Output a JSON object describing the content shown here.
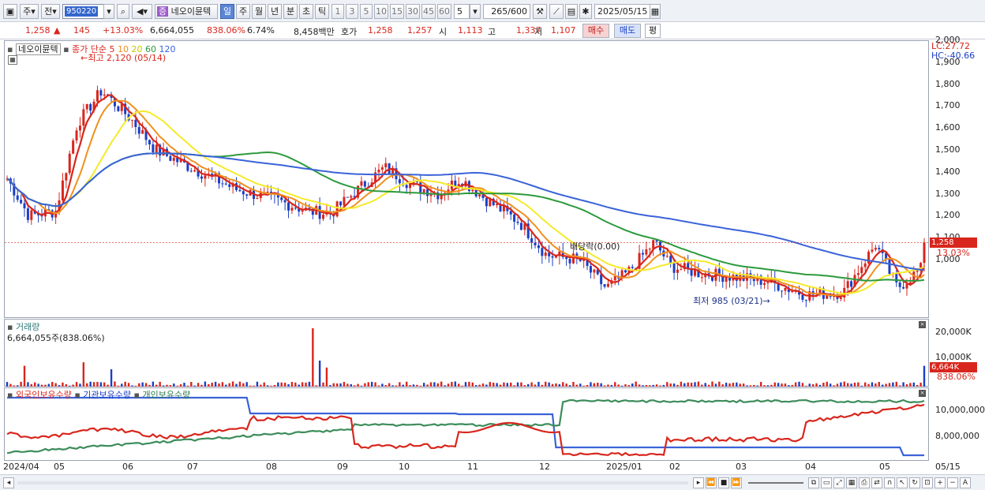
{
  "toolbar": {
    "mode1": "주",
    "mode2": "전",
    "code": "950220",
    "name": "네오이뮨텍",
    "periods": [
      "일",
      "주",
      "월",
      "년",
      "분",
      "초",
      "틱"
    ],
    "intervals": [
      "1",
      "3",
      "5",
      "10",
      "15",
      "30",
      "45",
      "60"
    ],
    "interval_value": "5",
    "count": "265",
    "count_total": "/600",
    "date": "2025/05/15"
  },
  "quote": {
    "price": "1,258",
    "change": "145",
    "change_pct": "+13.03%",
    "volume": "6,664,055",
    "volume_pct": "838.06%",
    "turnover_pct": "6.74%",
    "amount": "8,458백만",
    "hoga_label": "호가",
    "ask": "1,258",
    "bid": "1,257",
    "open_label": "시",
    "open": "1,113",
    "high_label": "고",
    "high": "1,337",
    "low_label": "저",
    "low": "1,107",
    "buy_btn": "매수",
    "sell_btn": "매도",
    "eval_btn": "평"
  },
  "price_panel": {
    "name": "네오이뮨텍",
    "legend": "종가 단순",
    "ma_labels": [
      "5",
      "10",
      "20",
      "60",
      "120"
    ],
    "ma_colors": [
      "#d8261d",
      "#f0901e",
      "#e8e81a",
      "#2c9a3c",
      "#3a63d8"
    ],
    "high_note": "최고 2,120 (05/14)",
    "low_note": "최저 985 (03/21)",
    "dividend_note": "배당락(0.00)",
    "lc": "LC:27.72",
    "hc": "HC:-40.66",
    "price_badge": "1,258",
    "pct_badge": "13.03%",
    "y_labels": [
      "2,000",
      "1,900",
      "1,800",
      "1,700",
      "1,600",
      "1,500",
      "1,400",
      "1,300",
      "1,200",
      "1,100",
      "1,000"
    ]
  },
  "volume_panel": {
    "title": "거래량",
    "value": "6,664,055주(838.06%)",
    "y_labels": [
      "20,000K",
      "10,000K"
    ],
    "badge1": "6,664K",
    "badge2": "838.06%"
  },
  "holder_panel": {
    "titles": [
      "외국인보유수량",
      "기관보유수량",
      "개인보유수량"
    ],
    "y_labels": [
      "10,000,000",
      "8,000,000"
    ]
  },
  "x_labels": [
    "2024/04",
    "05",
    "06",
    "07",
    "08",
    "09",
    "10",
    "11",
    "12",
    "2025/01",
    "02",
    "03",
    "04",
    "05",
    "05/15"
  ]
}
